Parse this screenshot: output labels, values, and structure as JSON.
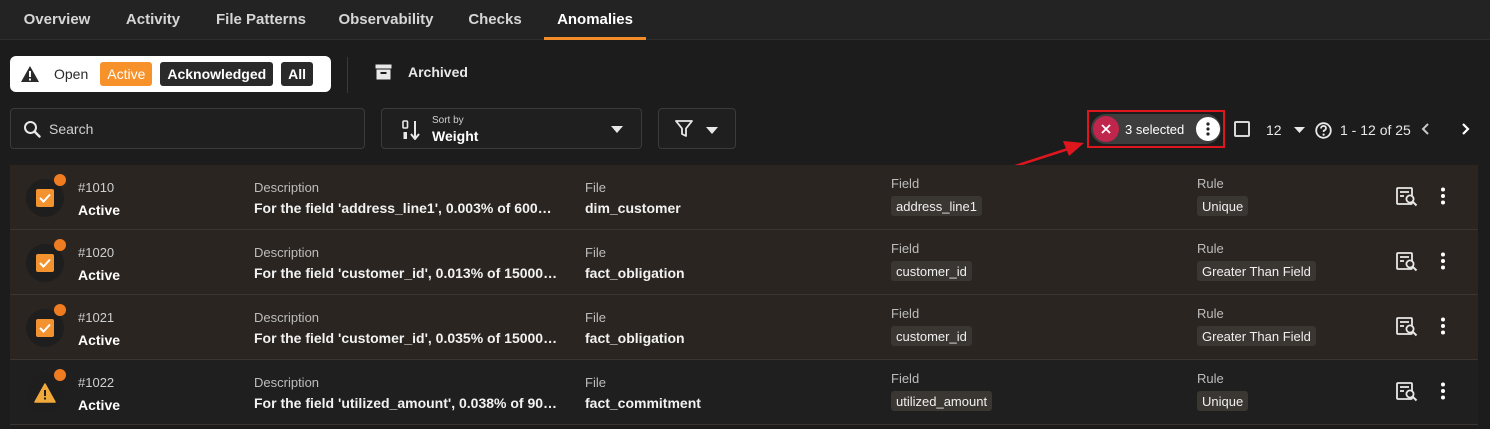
{
  "tabs": [
    {
      "label": "Overview"
    },
    {
      "label": "Activity"
    },
    {
      "label": "File Patterns"
    },
    {
      "label": "Observability"
    },
    {
      "label": "Checks"
    },
    {
      "label": "Anomalies"
    }
  ],
  "active_tab": "Anomalies",
  "status_filter": {
    "open": "Open",
    "active": "Active",
    "acknowledged": "Acknowledged",
    "all": "All",
    "selected": "Active"
  },
  "archived_label": "Archived",
  "search": {
    "placeholder": "Search",
    "value": ""
  },
  "sort": {
    "label": "Sort by",
    "value": "Weight"
  },
  "selection": {
    "count_text": "3 selected"
  },
  "pagination": {
    "per_page": "12",
    "range": "1 - 12 of 25"
  },
  "columns": {
    "description": "Description",
    "file": "File",
    "field": "Field",
    "rule": "Rule"
  },
  "rows": [
    {
      "id": "#1010",
      "status": "Active",
      "description": "For the field 'address_line1', 0.003% of 60000 …",
      "file": "dim_customer",
      "field": "address_line1",
      "rule": "Unique",
      "selected": true
    },
    {
      "id": "#1020",
      "status": "Active",
      "description": "For the field 'customer_id', 0.013% of 150000 r…",
      "file": "fact_obligation",
      "field": "customer_id",
      "rule": "Greater Than Field",
      "selected": true
    },
    {
      "id": "#1021",
      "status": "Active",
      "description": "For the field 'customer_id', 0.035% of 150000 r…",
      "file": "fact_obligation",
      "field": "customer_id",
      "rule": "Greater Than Field",
      "selected": true
    },
    {
      "id": "#1022",
      "status": "Active",
      "description": "For the field 'utilized_amount', 0.038% of 900…",
      "file": "fact_commitment",
      "field": "utilized_amount",
      "rule": "Unique",
      "selected": false
    }
  ],
  "colors": {
    "accent": "#f28c28",
    "highlight_box": "#e0161f",
    "clear_selection": "#c0254b"
  }
}
